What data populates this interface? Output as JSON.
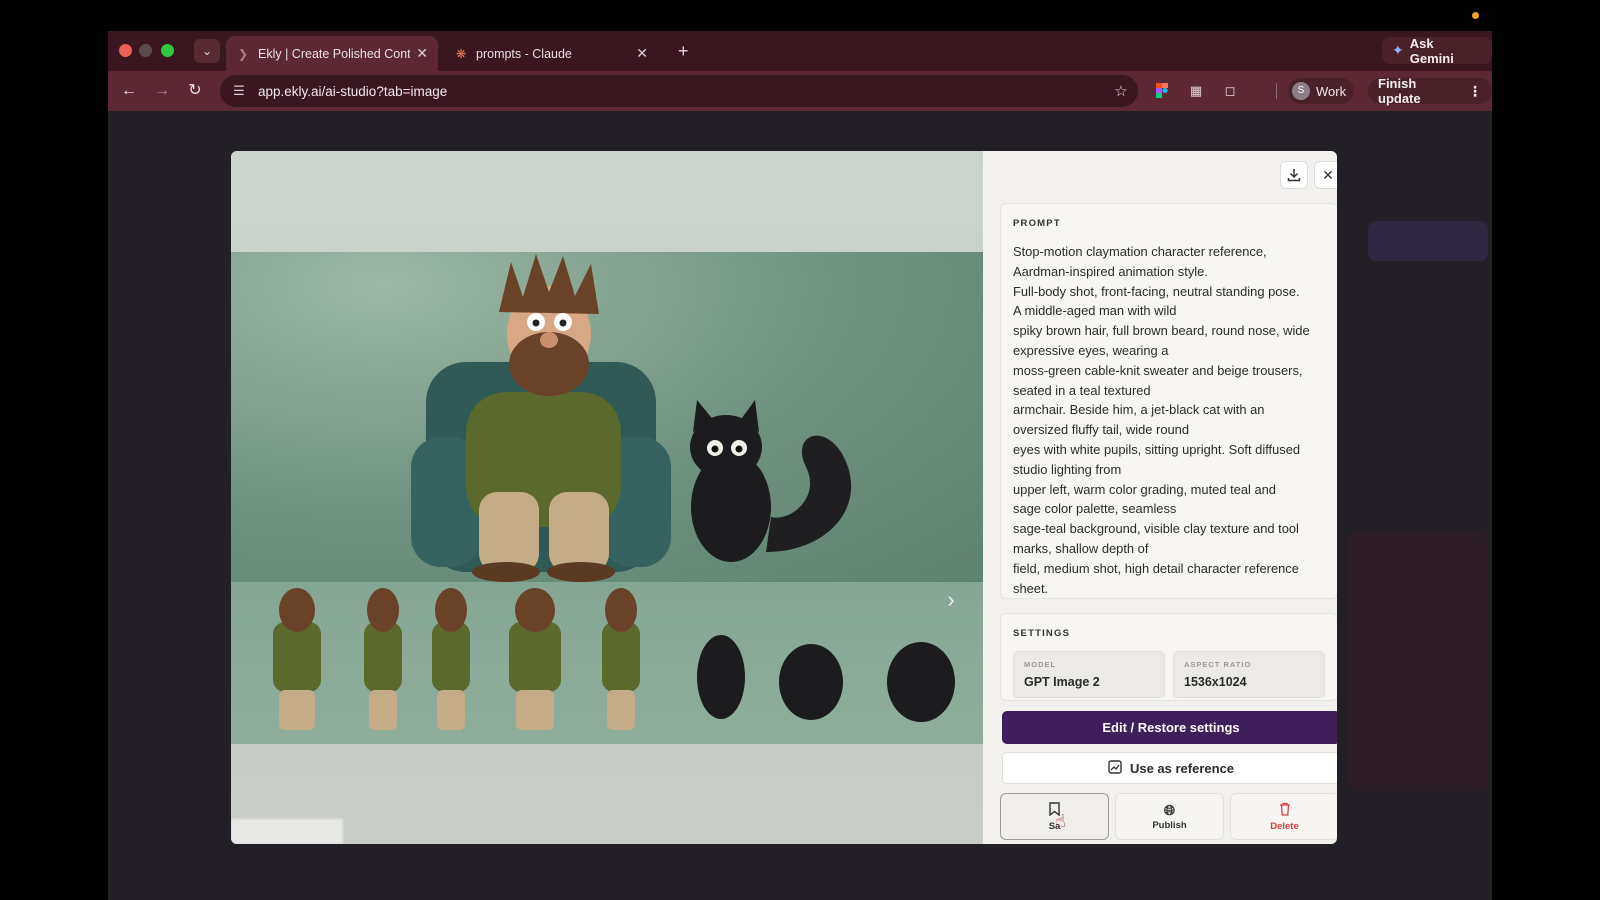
{
  "browser": {
    "tabs": [
      {
        "title": "Ekly | Create Polished Conten",
        "active": true
      },
      {
        "title": "prompts - Claude",
        "active": false
      }
    ],
    "ask_gemini_label": "Ask Gemini",
    "url": "app.ekly.ai/ai-studio?tab=image",
    "profile_initial": "S",
    "profile_label": "Work",
    "finish_update_label": "Finish update"
  },
  "modal": {
    "prompt": {
      "label": "PROMPT",
      "lines": [
        "Stop-motion claymation character reference,",
        "Aardman-inspired animation style.",
        "Full-body shot, front-facing, neutral standing pose.",
        "A middle-aged man with wild",
        "spiky brown hair, full brown beard, round nose, wide",
        "expressive eyes, wearing a",
        "moss-green cable-knit sweater and beige trousers,",
        "seated in a teal textured",
        "armchair. Beside him, a jet-black cat with an",
        "oversized fluffy tail, wide round",
        "eyes with white pupils, sitting upright. Soft diffused",
        "studio lighting from",
        "upper left, warm color grading, muted teal and",
        "sage color palette, seamless",
        "sage-teal background, visible clay texture and tool",
        "marks, shallow depth of",
        "field, medium shot, high detail character reference",
        "sheet."
      ]
    },
    "settings": {
      "label": "SETTINGS",
      "model_label": "MODEL",
      "model_value": "GPT Image 2",
      "aspect_label": "ASPECT RATIO",
      "aspect_value": "1536x1024"
    },
    "edit_button": "Edit / Restore settings",
    "reference_button": "Use as reference",
    "actions": {
      "save": "Sa",
      "publish": "Publish",
      "delete": "Delete"
    }
  },
  "colors": {
    "accent_purple": "#3e1f5c",
    "danger_red": "#d24040",
    "tab_bar": "#3a1720",
    "toolbar": "#5d2834"
  }
}
